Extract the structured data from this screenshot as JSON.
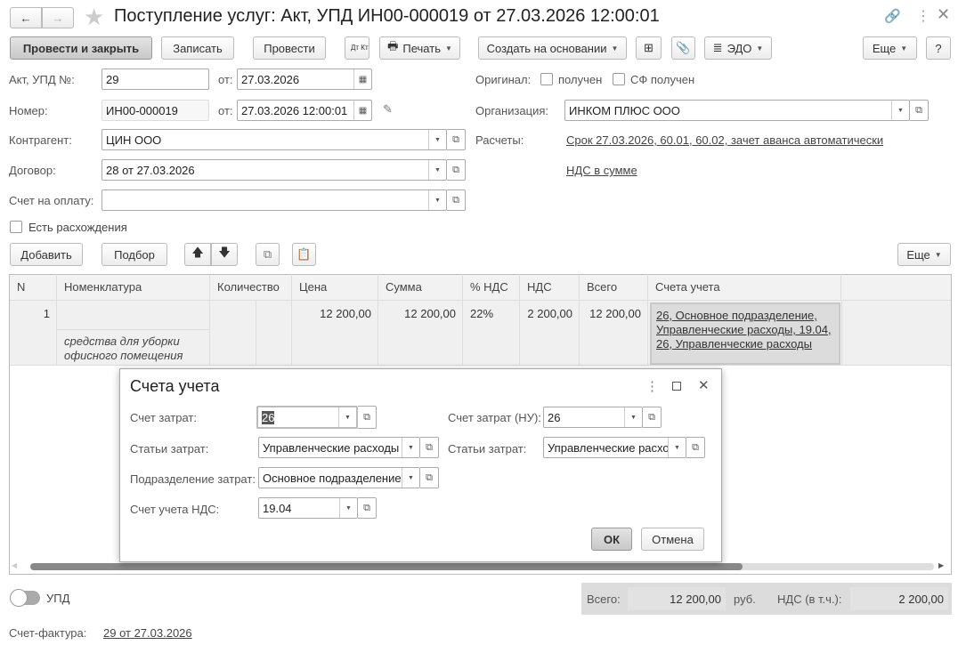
{
  "window": {
    "title": "Поступление услуг: Акт, УПД ИН00-000019 от 27.03.2026 12:00:01"
  },
  "toolbar": {
    "post_close": "Провести и закрыть",
    "save": "Записать",
    "post": "Провести",
    "dtkt": "Дт Кт",
    "print": "Печать",
    "create_based": "Создать на основании",
    "edo": "ЭДО",
    "more": "Еще",
    "help": "?"
  },
  "form": {
    "act_label": "Акт, УПД №:",
    "act_value": "29",
    "from_label": "от:",
    "act_date": "27.03.2026",
    "number_label": "Номер:",
    "number_value": "ИН00-000019",
    "number_date": "27.03.2026 12:00:01",
    "contractor_label": "Контрагент:",
    "contractor_value": "ЦИН ООО",
    "contract_label": "Договор:",
    "contract_value": "28 от 27.03.2026",
    "invoice_label": "Счет на оплату:",
    "invoice_value": "",
    "discrepancy_label": "Есть расхождения",
    "original_label": "Оригинал:",
    "received_label": "получен",
    "sf_received_label": "СФ получен",
    "org_label": "Организация:",
    "org_value": "ИНКОМ ПЛЮС ООО",
    "settlements_label": "Расчеты:",
    "settlements_link": "Срок 27.03.2026, 60.01, 60.02, зачет аванса автоматически",
    "vat_link": "НДС в сумме"
  },
  "table_toolbar": {
    "add": "Добавить",
    "pick": "Подбор",
    "more": "Еще"
  },
  "table": {
    "columns": [
      "N",
      "Номенклатура",
      "Количество",
      "Цена",
      "Сумма",
      "% НДС",
      "НДС",
      "Всего",
      "Счета учета"
    ],
    "rows": [
      {
        "n": "1",
        "nomenclature": "",
        "content": "средства для уборки офисного помещения",
        "qty": "",
        "price": "12 200,00",
        "sum": "12 200,00",
        "vat_rate": "22%",
        "vat": "2 200,00",
        "total": "12 200,00",
        "accounts": "26, Основное подразделение, Управленческие расходы, 19.04, 26, Управленческие расходы"
      }
    ]
  },
  "dialog": {
    "title": "Счета учета",
    "cost_account_label": "Счет затрат:",
    "cost_account": "26",
    "cost_account_nu_label": "Счет затрат (НУ):",
    "cost_account_nu": "26",
    "cost_items_label": "Статьи затрат:",
    "cost_items": "Управленческие расходы",
    "cost_items_nu_label": "Статьи затрат:",
    "cost_items_nu": "Управленческие расходы",
    "division_label": "Подразделение затрат:",
    "division": "Основное подразделение",
    "vat_account_label": "Счет учета НДС:",
    "vat_account": "19.04",
    "ok": "ОК",
    "cancel": "Отмена"
  },
  "footer": {
    "upd_label": "УПД",
    "total_label": "Всего:",
    "total": "12 200,00",
    "currency": "руб.",
    "vat_label": "НДС (в т.ч.):",
    "vat": "2 200,00",
    "invoice_label": "Счет-фактура:",
    "invoice_link": "29 от 27.03.2026"
  }
}
